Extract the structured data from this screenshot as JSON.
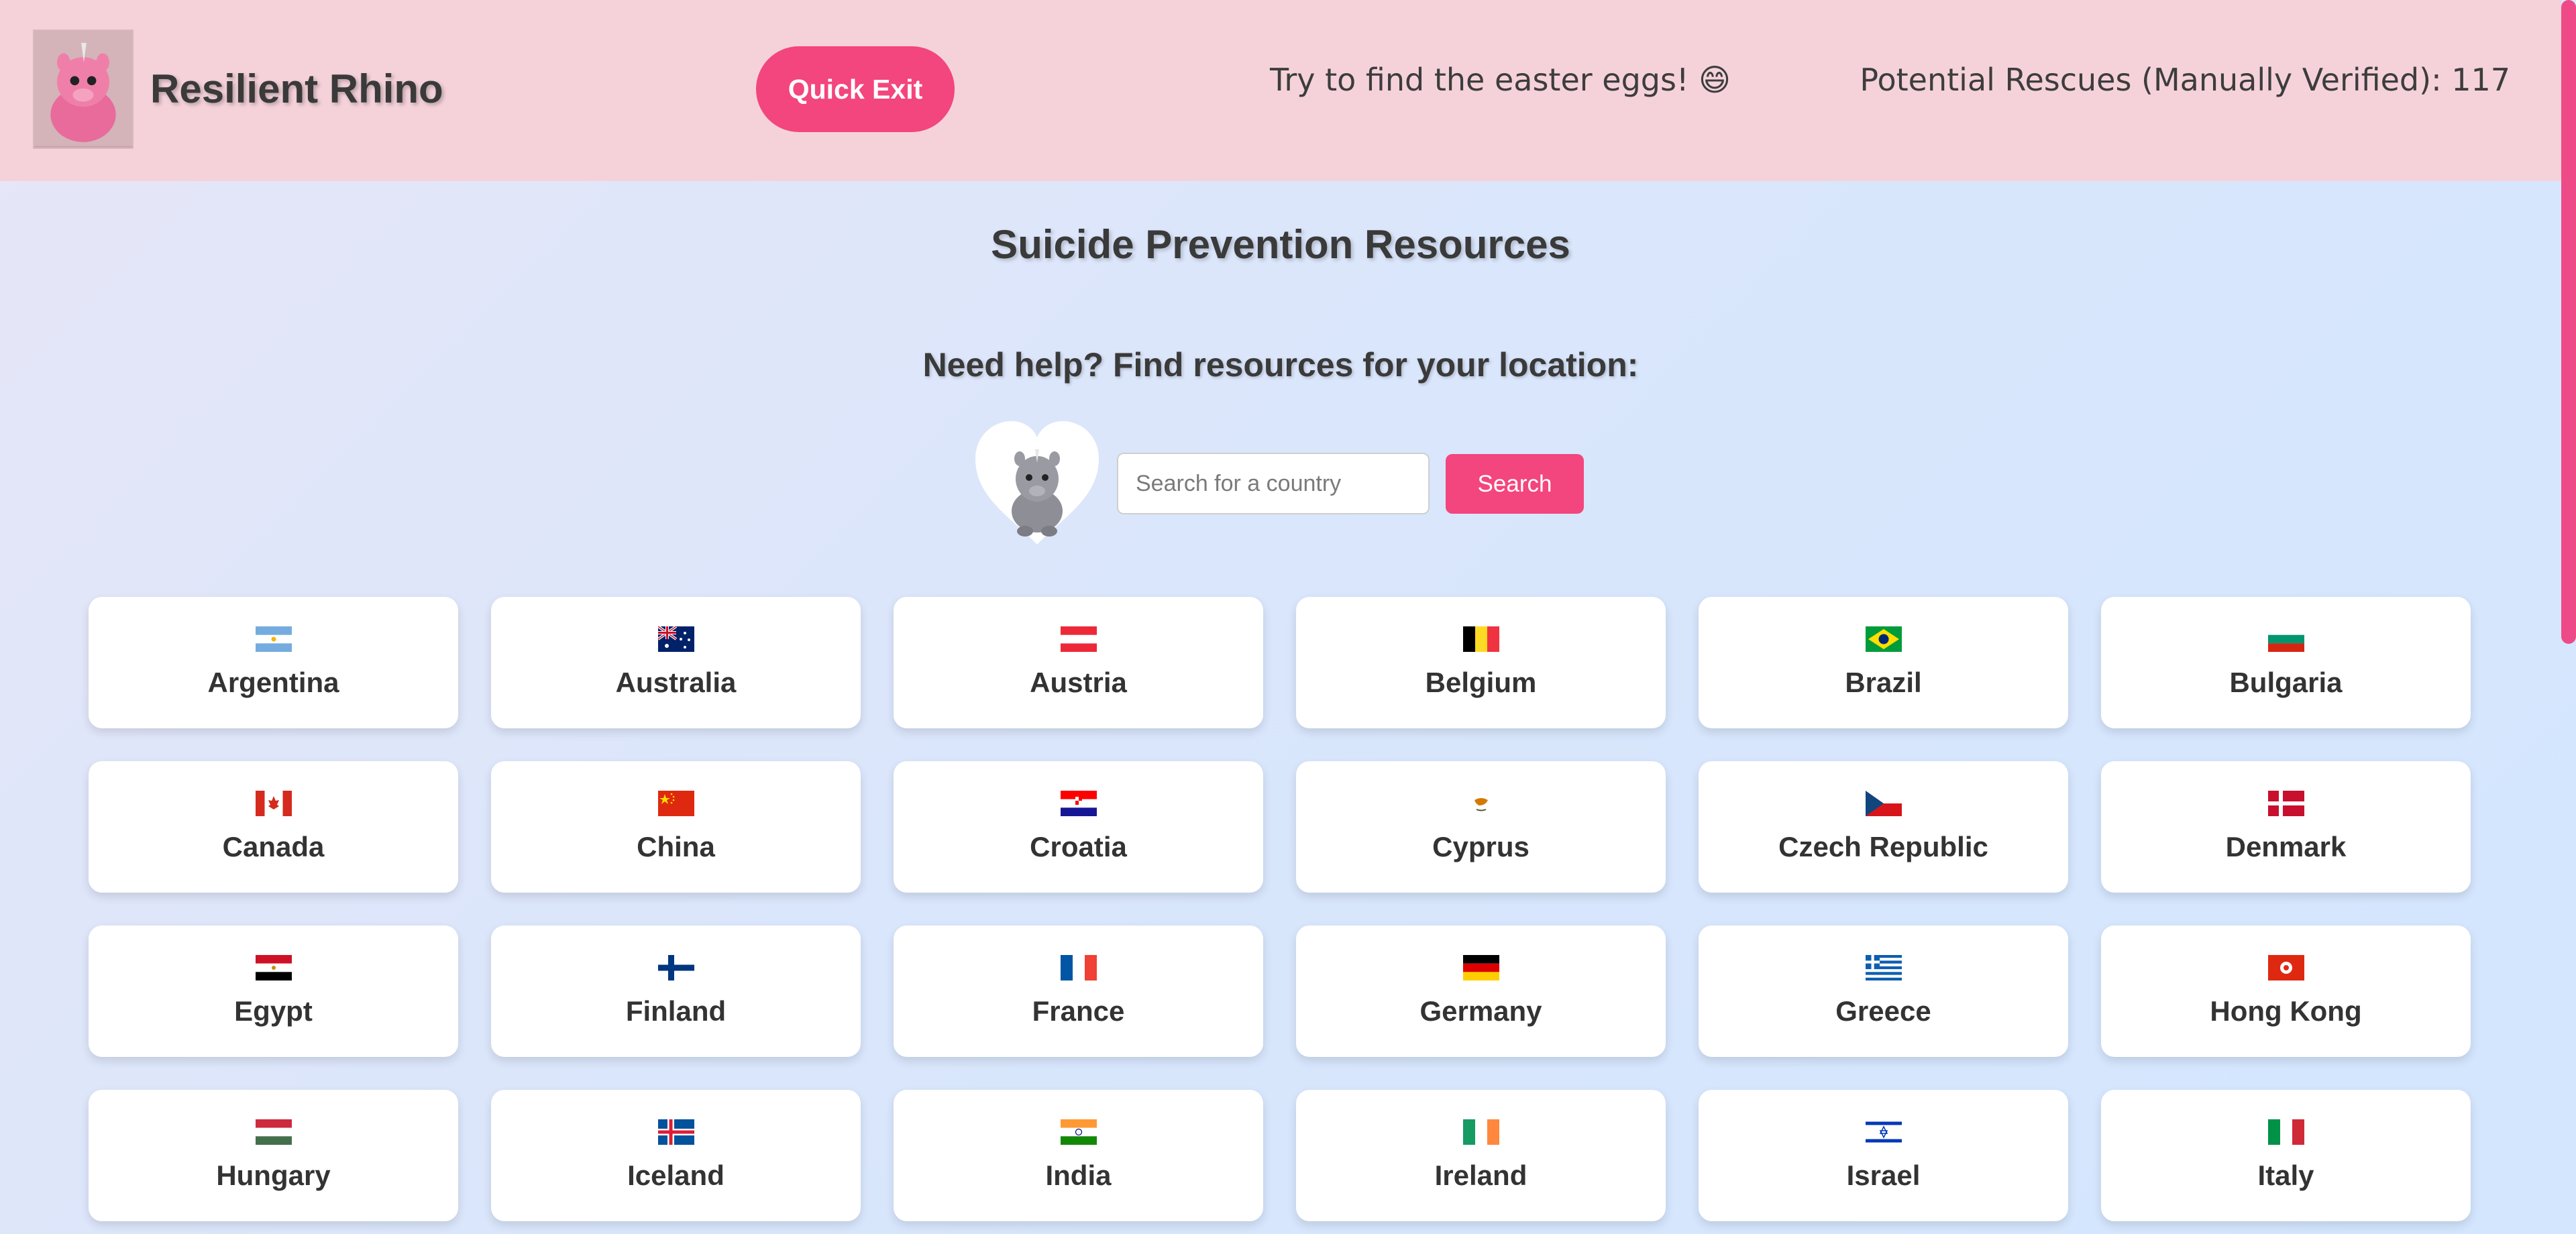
{
  "header": {
    "brand": "Resilient Rhino",
    "quick_exit_label": "Quick Exit",
    "easter_text": "Try to find the easter eggs! 😄",
    "rescues_text": "Potential Rescues (Manually Verified): 117"
  },
  "main": {
    "title": "Suicide Prevention Resources",
    "help_title": "Need help? Find resources for your location:",
    "search": {
      "placeholder": "Search for a country",
      "value": "",
      "button_label": "Search"
    }
  },
  "colors": {
    "accent": "#f3457e",
    "header_bg": "#f5d2da"
  },
  "countries": [
    {
      "name": "Argentina",
      "flag": "argentina-flag"
    },
    {
      "name": "Australia",
      "flag": "australia-flag"
    },
    {
      "name": "Austria",
      "flag": "austria-flag"
    },
    {
      "name": "Belgium",
      "flag": "belgium-flag"
    },
    {
      "name": "Brazil",
      "flag": "brazil-flag"
    },
    {
      "name": "Bulgaria",
      "flag": "bulgaria-flag"
    },
    {
      "name": "Canada",
      "flag": "canada-flag"
    },
    {
      "name": "China",
      "flag": "china-flag"
    },
    {
      "name": "Croatia",
      "flag": "croatia-flag"
    },
    {
      "name": "Cyprus",
      "flag": "cyprus-flag"
    },
    {
      "name": "Czech Republic",
      "flag": "czech-republic-flag"
    },
    {
      "name": "Denmark",
      "flag": "denmark-flag"
    },
    {
      "name": "Egypt",
      "flag": "egypt-flag"
    },
    {
      "name": "Finland",
      "flag": "finland-flag"
    },
    {
      "name": "France",
      "flag": "france-flag"
    },
    {
      "name": "Germany",
      "flag": "germany-flag"
    },
    {
      "name": "Greece",
      "flag": "greece-flag"
    },
    {
      "name": "Hong Kong",
      "flag": "hong-kong-flag"
    },
    {
      "name": "Hungary",
      "flag": "hungary-flag"
    },
    {
      "name": "Iceland",
      "flag": "iceland-flag"
    },
    {
      "name": "India",
      "flag": "india-flag"
    },
    {
      "name": "Ireland",
      "flag": "ireland-flag"
    },
    {
      "name": "Israel",
      "flag": "israel-flag"
    },
    {
      "name": "Italy",
      "flag": "italy-flag"
    }
  ]
}
